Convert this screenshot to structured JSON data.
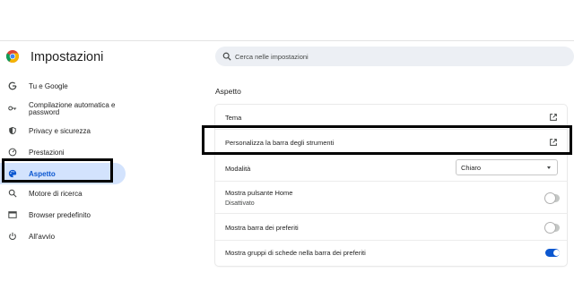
{
  "app": {
    "title": "Impostazioni",
    "logo_icon": "chrome-logo-icon"
  },
  "search": {
    "placeholder": "Cerca nelle impostazioni",
    "value": ""
  },
  "sidebar": {
    "items": [
      {
        "label": "Tu e Google",
        "icon": "google-g-icon",
        "active": false
      },
      {
        "label": "Compilazione automatica e password",
        "label_line1": "Compilazione automatica e",
        "label_line2": "password",
        "icon": "key-icon",
        "active": false
      },
      {
        "label": "Privacy e sicurezza",
        "icon": "shield-icon",
        "active": false
      },
      {
        "label": "Prestazioni",
        "icon": "speedometer-icon",
        "active": false
      },
      {
        "label": "Aspetto",
        "icon": "palette-icon",
        "active": true
      },
      {
        "label": "Motore di ricerca",
        "icon": "search-icon",
        "active": false
      },
      {
        "label": "Browser predefinito",
        "icon": "browser-window-icon",
        "active": false
      },
      {
        "label": "All'avvio",
        "icon": "power-icon",
        "active": false
      }
    ]
  },
  "main": {
    "section_title": "Aspetto",
    "rows": {
      "theme": {
        "label": "Tema",
        "icon": "open-in-new-icon"
      },
      "toolbar": {
        "label": "Personalizza la barra degli strumenti",
        "icon": "open-in-new-icon"
      },
      "mode": {
        "label": "Modalità",
        "selected": "Chiaro"
      },
      "home_button": {
        "label": "Mostra pulsante Home",
        "sublabel": "Disattivato",
        "enabled": false
      },
      "bookmarks_bar": {
        "label": "Mostra barra dei preferiti",
        "enabled": false
      },
      "tab_groups": {
        "label": "Mostra gruppi di schede nella barra dei preferiti",
        "enabled": true
      }
    }
  },
  "colors": {
    "accent": "#0b57d0",
    "active_bg": "#d3e3fd",
    "highlight_border": "#000000"
  }
}
